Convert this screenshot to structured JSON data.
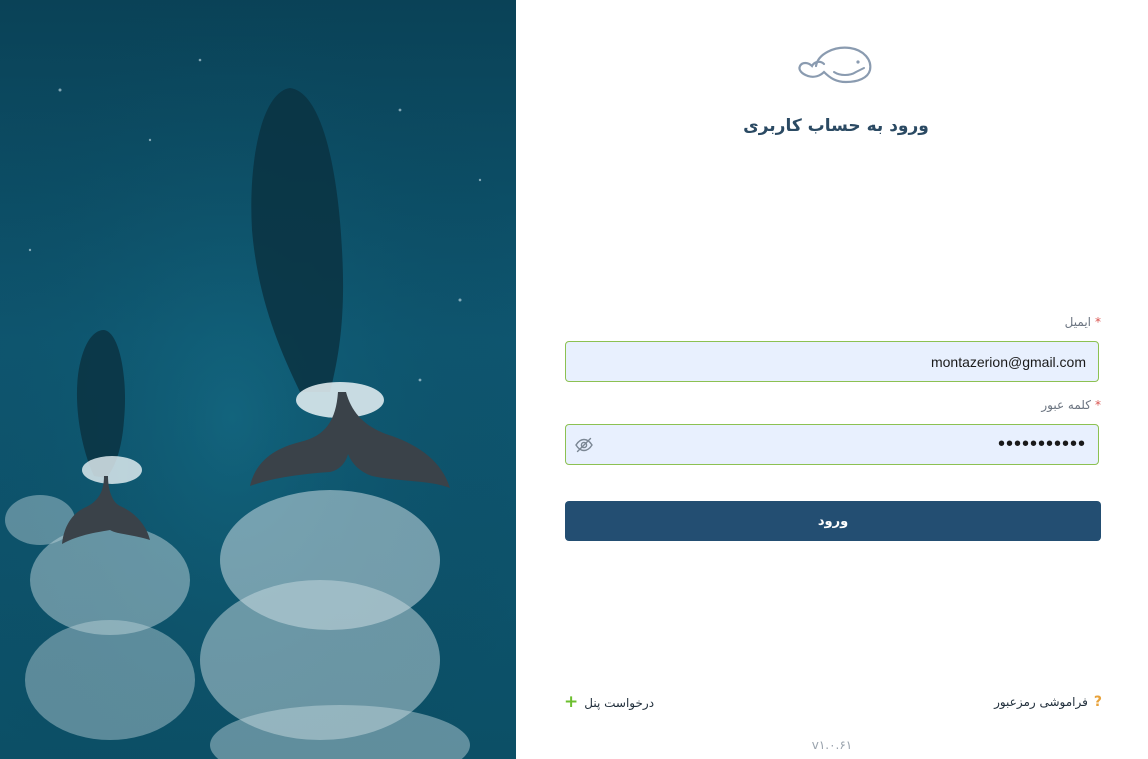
{
  "login": {
    "title": "ورود به حساب کاربری",
    "email_label": "ایمیل",
    "email_value": "montazerion@gmail.com",
    "password_label": "کلمه عبور",
    "password_value": "•••••••••••",
    "required_mark": "*",
    "submit_label": "ورود",
    "forgot_label": "فراموشی رمزعبور",
    "request_panel_label": "درخواست پنل",
    "version": "v۱.۰.۶۱"
  },
  "icons": {
    "logo": "whale-logo-icon",
    "eye": "eye-off-icon",
    "question": "question-icon",
    "plus": "plus-icon"
  },
  "colors": {
    "primary": "#234e72",
    "input_border": "#8cc152",
    "input_bg": "#e8f0fe",
    "required": "#d9534f",
    "question_icon": "#e8a23a",
    "plus_icon": "#6cbf2f"
  }
}
